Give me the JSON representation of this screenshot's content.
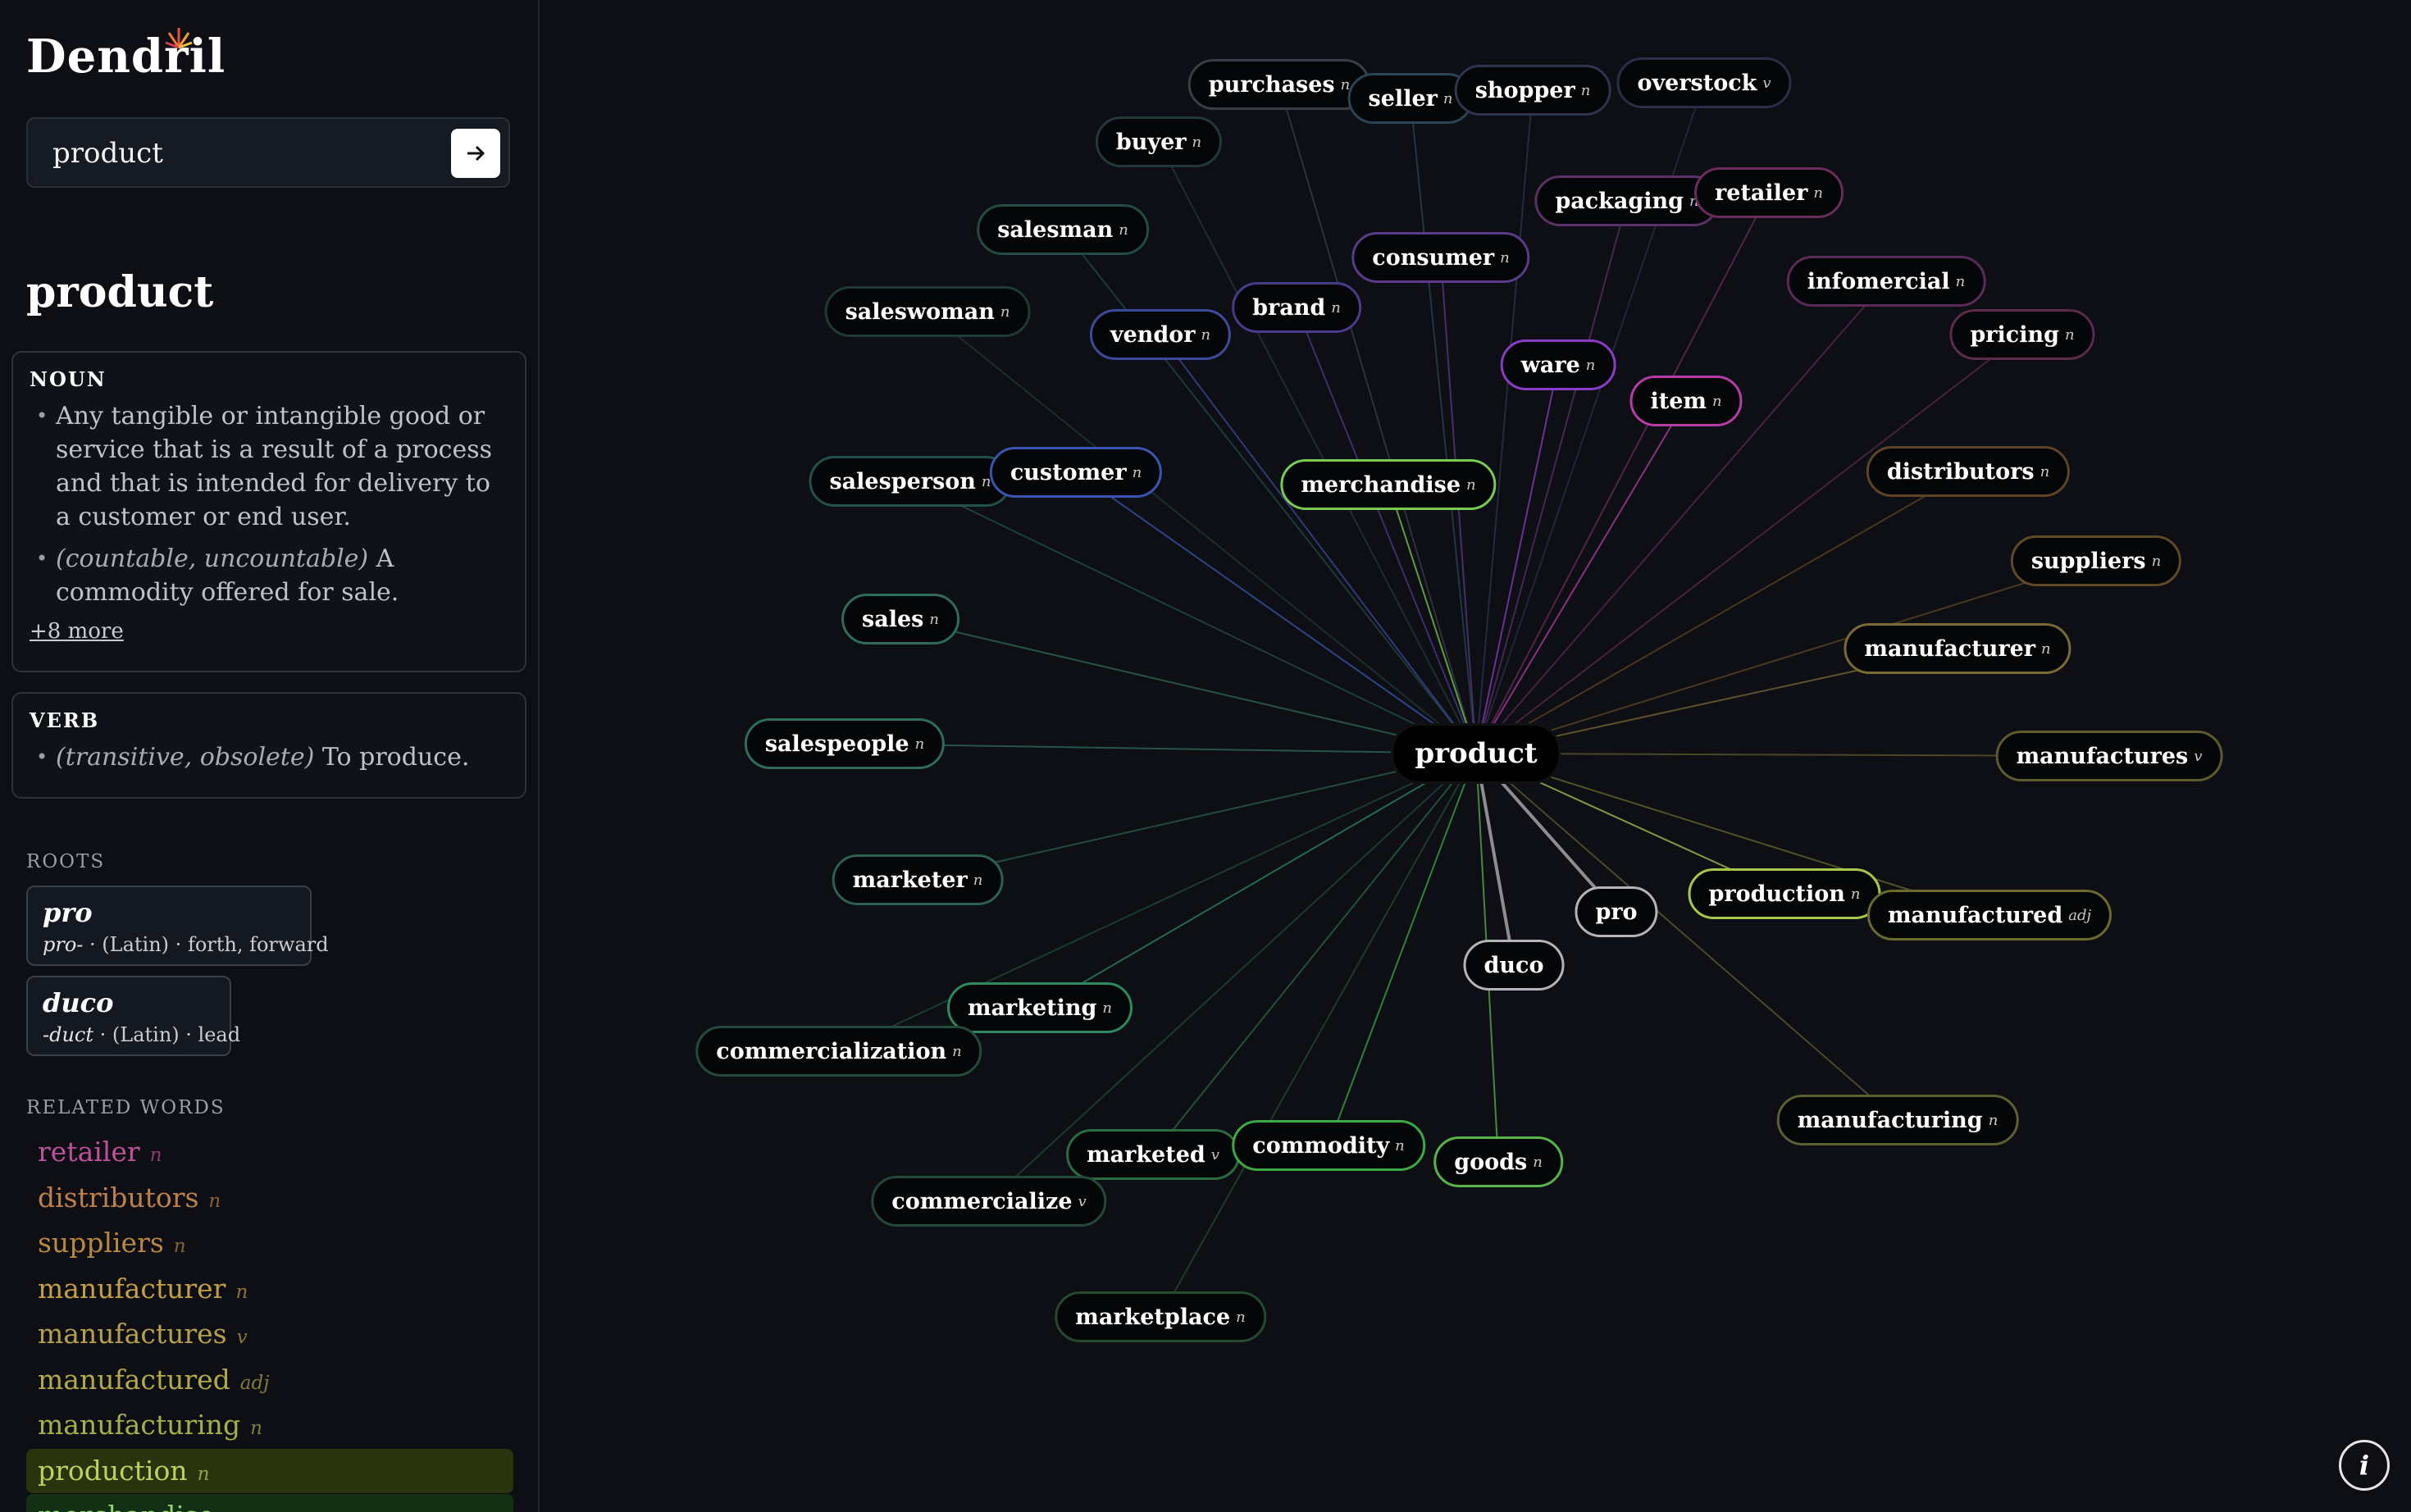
{
  "app": {
    "title": "Dendril"
  },
  "search": {
    "value": "product",
    "submit_icon": "arrow-right-icon"
  },
  "word": "product",
  "definitions": [
    {
      "pos": "NOUN",
      "senses": [
        {
          "qualifier": "",
          "text": "Any tangible or intangible good or service that is a result of a process and that is intended for delivery to a customer or end user."
        },
        {
          "qualifier": "(countable, uncountable)",
          "text": "A commodity offered for sale."
        }
      ],
      "more": "+8 more"
    },
    {
      "pos": "VERB",
      "senses": [
        {
          "qualifier": "(transitive, obsolete)",
          "text": "To produce."
        }
      ]
    }
  ],
  "roots_label": "ROOTS",
  "roots": [
    {
      "name": "pro",
      "form": "pro-",
      "lang": "(Latin)",
      "gloss": "forth, forward"
    },
    {
      "name": "duco",
      "form": "-duct",
      "lang": "(Latin)",
      "gloss": "lead"
    }
  ],
  "related_label": "RELATED WORDS",
  "related_words": [
    {
      "word": "retailer",
      "pos": "n",
      "color": "#c0509c"
    },
    {
      "word": "distributors",
      "pos": "n",
      "color": "#c0804a"
    },
    {
      "word": "suppliers",
      "pos": "n",
      "color": "#b9883f"
    },
    {
      "word": "manufacturer",
      "pos": "n",
      "color": "#c49f44"
    },
    {
      "word": "manufactures",
      "pos": "v",
      "color": "#b7a04a"
    },
    {
      "word": "manufactured",
      "pos": "adj",
      "color": "#b3aa46"
    },
    {
      "word": "manufacturing",
      "pos": "n",
      "color": "#a6b04a"
    },
    {
      "word": "production",
      "pos": "n",
      "color": "#b9d45c",
      "highlight": "#29330e"
    },
    {
      "word": "merchandise",
      "pos": "n",
      "color": "#8fd470",
      "highlight": "#143014"
    }
  ],
  "graph": {
    "center": "product",
    "nodes": [
      {
        "word": "purchases",
        "pos": "n",
        "color": "#3a3d46"
      },
      {
        "word": "seller",
        "pos": "n",
        "color": "#2c4356"
      },
      {
        "word": "shopper",
        "pos": "n",
        "color": "#2f3450"
      },
      {
        "word": "overstock",
        "pos": "v",
        "color": "#2a2e48"
      },
      {
        "word": "buyer",
        "pos": "n",
        "color": "#23383c"
      },
      {
        "word": "packaging",
        "pos": "n",
        "color": "#5a3066"
      },
      {
        "word": "retailer",
        "pos": "n",
        "color": "#6a2c5a"
      },
      {
        "word": "salesman",
        "pos": "n",
        "color": "#234a44"
      },
      {
        "word": "consumer",
        "pos": "n",
        "color": "#5a3a8a"
      },
      {
        "word": "infomercial",
        "pos": "n",
        "color": "#5a2a58"
      },
      {
        "word": "saleswoman",
        "pos": "n",
        "color": "#1f3a36"
      },
      {
        "word": "vendor",
        "pos": "n",
        "color": "#3b4a9a"
      },
      {
        "word": "brand",
        "pos": "n",
        "color": "#4a3a8a"
      },
      {
        "word": "pricing",
        "pos": "n",
        "color": "#5c2a4c"
      },
      {
        "word": "ware",
        "pos": "n",
        "color": "#8a3cc6"
      },
      {
        "word": "item",
        "pos": "n",
        "color": "#b63ca6"
      },
      {
        "word": "distributors",
        "pos": "n",
        "color": "#5e4424"
      },
      {
        "word": "salesperson",
        "pos": "n",
        "color": "#24504a"
      },
      {
        "word": "customer",
        "pos": "n",
        "color": "#3a55b0"
      },
      {
        "word": "merchandise",
        "pos": "n",
        "color": "#79cc52"
      },
      {
        "word": "suppliers",
        "pos": "n",
        "color": "#5e4a26"
      },
      {
        "word": "sales",
        "pos": "n",
        "color": "#2f6a5a"
      },
      {
        "word": "manufacturer",
        "pos": "n",
        "color": "#7a6a34"
      },
      {
        "word": "salespeople",
        "pos": "n",
        "color": "#2e6c5c"
      },
      {
        "word": "manufactures",
        "pos": "v",
        "color": "#5e5a2e"
      },
      {
        "word": "marketer",
        "pos": "n",
        "color": "#2c6050"
      },
      {
        "word": "pro",
        "pos": "",
        "color": "#b4b4b8"
      },
      {
        "word": "production",
        "pos": "n",
        "color": "#a8c84c"
      },
      {
        "word": "manufactured",
        "pos": "adj",
        "color": "#6a6a2c"
      },
      {
        "word": "duco",
        "pos": "",
        "color": "#b4b4b8"
      },
      {
        "word": "marketing",
        "pos": "n",
        "color": "#2c8a5e"
      },
      {
        "word": "commercialization",
        "pos": "n",
        "color": "#234a3c"
      },
      {
        "word": "manufacturing",
        "pos": "n",
        "color": "#5a6030"
      },
      {
        "word": "marketed",
        "pos": "v",
        "color": "#2c6a40"
      },
      {
        "word": "commodity",
        "pos": "n",
        "color": "#3caa44"
      },
      {
        "word": "goods",
        "pos": "n",
        "color": "#58b44a"
      },
      {
        "word": "commercialize",
        "pos": "v",
        "color": "#24483a"
      },
      {
        "word": "marketplace",
        "pos": "n",
        "color": "#244a30"
      }
    ]
  },
  "info_button": "i"
}
